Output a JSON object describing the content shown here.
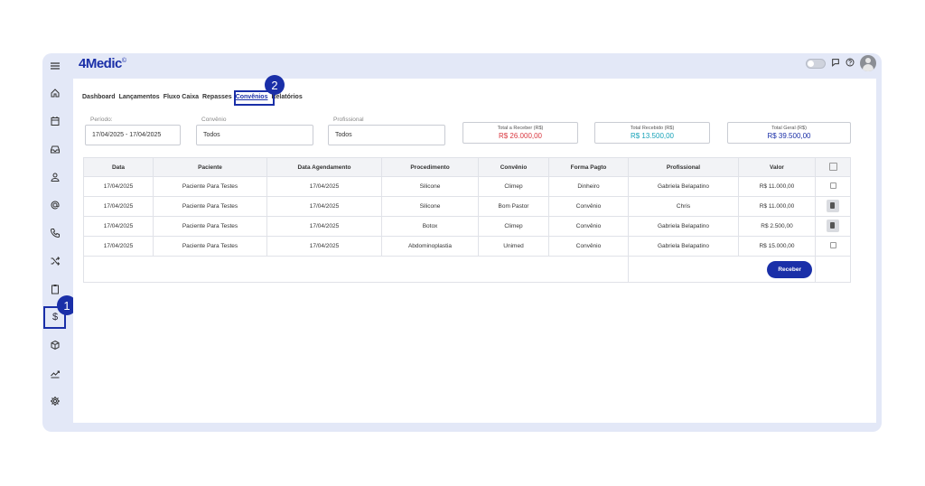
{
  "app": {
    "logo": "4Medic",
    "logo_mark": "©"
  },
  "sidebar": {
    "items": [
      {
        "name": "menu",
        "icon": "hamburger-menu-icon"
      },
      {
        "name": "home",
        "icon": "home-icon"
      },
      {
        "name": "calendar",
        "icon": "calendar-icon"
      },
      {
        "name": "inbox",
        "icon": "inbox-icon"
      },
      {
        "name": "user",
        "icon": "user-icon"
      },
      {
        "name": "at",
        "icon": "at-sign-icon"
      },
      {
        "name": "phone",
        "icon": "phone-icon"
      },
      {
        "name": "shuffle",
        "icon": "shuffle-icon"
      },
      {
        "name": "clipboard",
        "icon": "clipboard-icon"
      },
      {
        "name": "financeiro",
        "icon": "dollar-icon",
        "label": "$"
      },
      {
        "name": "package",
        "icon": "package-icon"
      },
      {
        "name": "chart",
        "icon": "chart-icon"
      },
      {
        "name": "settings",
        "icon": "gear-icon"
      }
    ]
  },
  "annotations": {
    "badge1": "1",
    "badge2": "2",
    "color": "#1a2fa8"
  },
  "tabs": [
    "Dashboard",
    "Lançamentos",
    "Fluxo Caixa",
    "Repasses",
    "Convênios",
    "Relatórios"
  ],
  "filters": {
    "periodo": {
      "label": "Período:",
      "value": "17/04/2025 - 17/04/2025"
    },
    "convenio": {
      "label": "Convênio",
      "value": "Todos"
    },
    "profissional": {
      "label": "Profissional",
      "value": "Todos"
    }
  },
  "totals": {
    "a_receber": {
      "label": "Total a Receber (R$)",
      "value": "R$ 26.000,00",
      "color": "#d9363e"
    },
    "recebido": {
      "label": "Total Recebido (R$)",
      "value": "R$ 13.500,00",
      "color": "#17a2b8"
    },
    "geral": {
      "label": "Total Geral (R$)",
      "value": "R$ 39.500,00",
      "color": "#1a2fa8"
    }
  },
  "table": {
    "headers": [
      "Data",
      "Paciente",
      "Data Agendamento",
      "Procedimento",
      "Convênio",
      "Forma Pagto",
      "Profissional",
      "Valor"
    ],
    "rows": [
      [
        "17/04/2025",
        "Paciente Para Testes",
        "17/04/2025",
        "Silicone",
        "Climep",
        "Dinheiro",
        "Gabriela Belapatino",
        "R$ 11.000,00"
      ],
      [
        "17/04/2025",
        "Paciente Para Testes",
        "17/04/2025",
        "Silicone",
        "Bom Pastor",
        "Convênio",
        "Chris",
        "R$ 11.000,00"
      ],
      [
        "17/04/2025",
        "Paciente Para Testes",
        "17/04/2025",
        "Botox",
        "Climep",
        "Convênio",
        "Gabriela Belapatino",
        "R$ 2.500,00"
      ],
      [
        "17/04/2025",
        "Paciente Para Testes",
        "17/04/2025",
        "Abdominoplastia",
        "Unimed",
        "Convênio",
        "Gabriela Belapatino",
        "R$ 15.000,00"
      ]
    ],
    "row_actions": [
      "checkbox",
      "document",
      "document",
      "checkbox"
    ],
    "receber_label": "Receber"
  }
}
